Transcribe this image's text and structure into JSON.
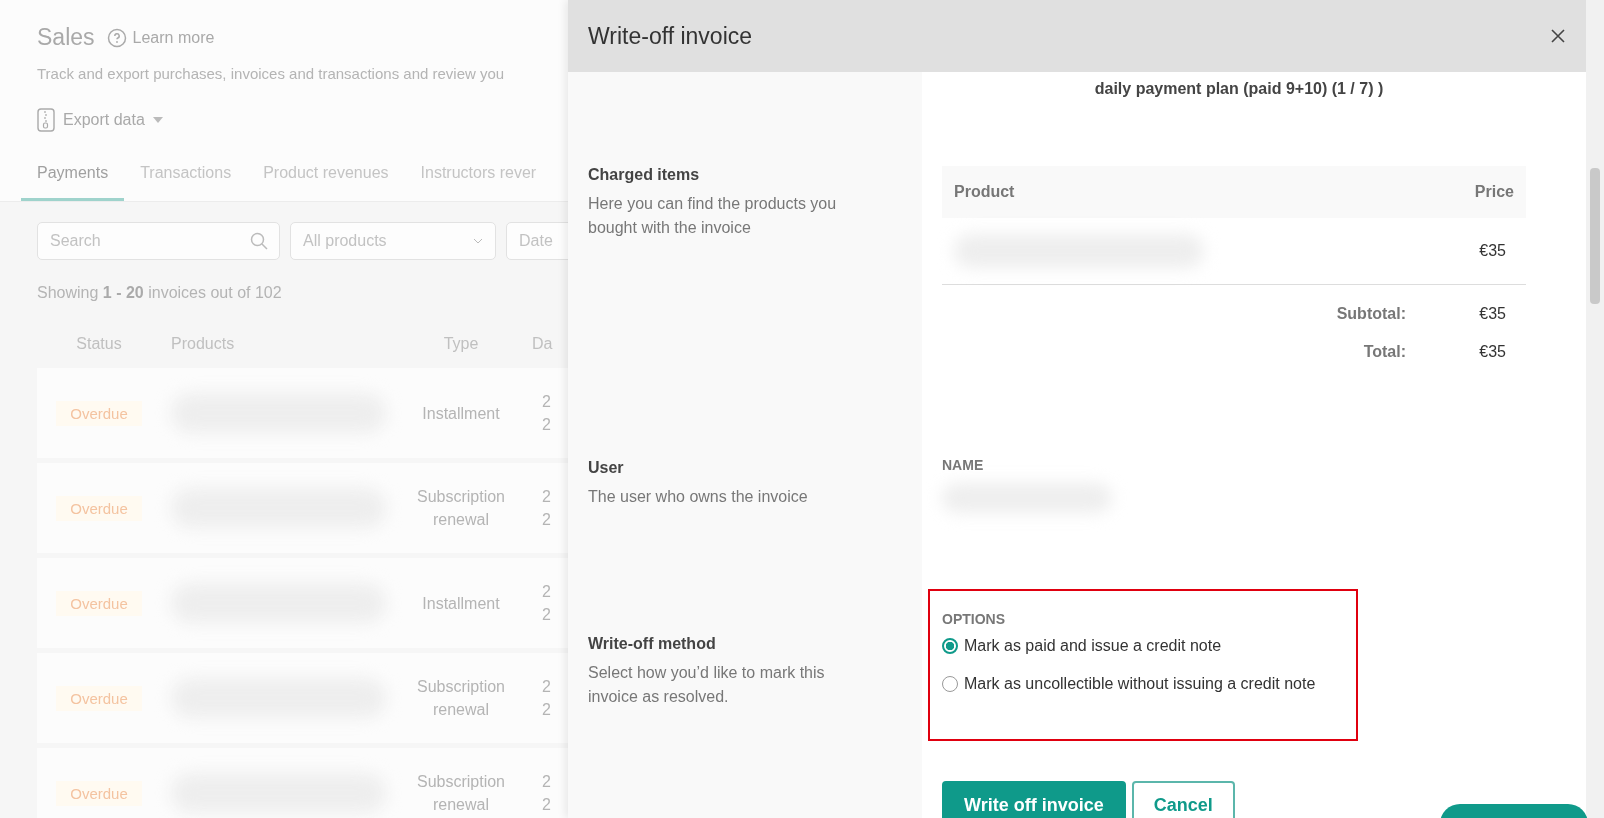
{
  "page": {
    "title": "Sales",
    "learn_more": "Learn more",
    "subtitle": "Track and export purchases, invoices and transactions and review you",
    "export": "Export data"
  },
  "tabs": [
    {
      "label": "Payments",
      "selected": true
    },
    {
      "label": "Transactions",
      "selected": false
    },
    {
      "label": "Product revenues",
      "selected": false
    },
    {
      "label": "Instructors rever",
      "selected": false
    }
  ],
  "filters": {
    "search_placeholder": "Search",
    "products": "All products",
    "date": "Date"
  },
  "summary": "Showing **1 - 20** invoices out of 102",
  "table": {
    "columns": [
      "Status",
      "Products",
      "Type",
      "Da"
    ],
    "rows": [
      {
        "status": "Overdue",
        "type": "Installment",
        "date": [
          "2",
          "2"
        ]
      },
      {
        "status": "Overdue",
        "type": "Subscription renewal",
        "date": [
          "2",
          "2"
        ]
      },
      {
        "status": "Overdue",
        "type": "Installment",
        "date": [
          "2",
          "2"
        ]
      },
      {
        "status": "Overdue",
        "type": "Subscription renewal",
        "date": [
          "2",
          "2"
        ]
      },
      {
        "status": "Overdue",
        "type": "Subscription renewal",
        "date": [
          "2",
          "2"
        ]
      }
    ]
  },
  "drawer": {
    "title": "Write-off invoice",
    "top_text": "daily payment plan (paid 9+10) (1 / 7) )",
    "sections": [
      {
        "kind": "items",
        "heading": "Charged items",
        "description": "Here you can find the products you bought with the invoice",
        "columns": [
          "Product",
          "Price"
        ],
        "items": [
          {
            "price": "€35"
          }
        ],
        "totals": [
          {
            "label": "Subtotal:",
            "value": "€35"
          },
          {
            "label": "Total:",
            "value": "€35"
          }
        ]
      },
      {
        "kind": "user",
        "heading": "User",
        "description": "The user who owns the invoice",
        "label": "NAME"
      },
      {
        "kind": "options",
        "heading": "Write-off method",
        "description": "Select how you’d like to mark this invoice as resolved.",
        "label": "OPTIONS",
        "options": [
          {
            "label": "Mark as paid and issue a credit note",
            "selected": true
          },
          {
            "label": "Mark as uncollectible without issuing a credit note",
            "selected": false
          }
        ]
      }
    ],
    "buttons": [
      {
        "label": "Write off invoice",
        "kind": "primary"
      },
      {
        "label": "Cancel",
        "kind": "secondary"
      }
    ]
  }
}
